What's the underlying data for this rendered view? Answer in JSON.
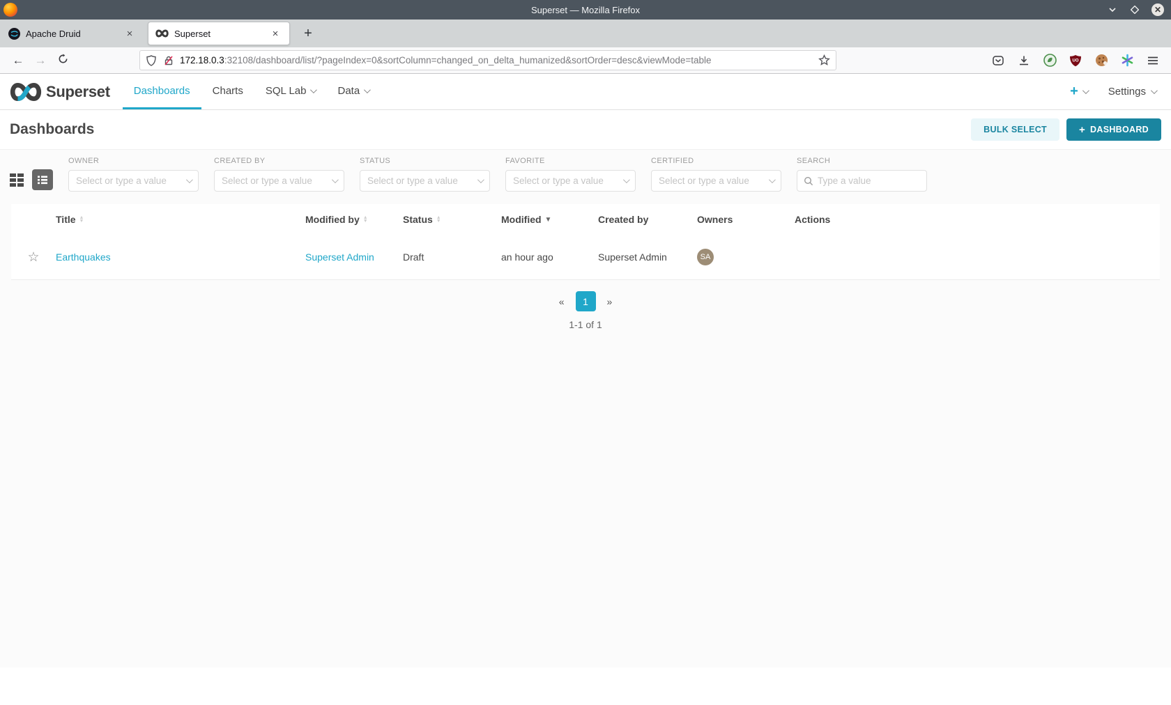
{
  "titlebar": {
    "title": "Superset — Mozilla Firefox"
  },
  "tabs": {
    "tab1": "Apache Druid",
    "tab2": "Superset",
    "close": "×",
    "new_tab": "+"
  },
  "browser": {
    "back": "←",
    "forward": "→",
    "url_host": "172.18.0.3",
    "url_rest": ":32108/dashboard/list/?pageIndex=0&sortColumn=changed_on_delta_humanized&sortOrder=desc&viewMode=table",
    "toolbar_icons": [
      "pocket-icon",
      "download-icon",
      "privacy-extension-icon",
      "ublock-icon",
      "cookie-extension-icon",
      "multiaccount-extension-icon",
      "menu-icon"
    ]
  },
  "navbar": {
    "brand": "Superset",
    "items": [
      {
        "label": "Dashboards"
      },
      {
        "label": "Charts"
      },
      {
        "label": "SQL Lab"
      },
      {
        "label": "Data"
      }
    ],
    "plus": "+",
    "settings": "Settings"
  },
  "submenu": {
    "title": "Dashboards",
    "bulk_select": "BULK SELECT",
    "new_plus": "+",
    "new_dashboard": "DASHBOARD"
  },
  "filters": {
    "owner": {
      "label": "OWNER",
      "placeholder": "Select or type a value"
    },
    "created_by": {
      "label": "CREATED BY",
      "placeholder": "Select or type a value"
    },
    "status": {
      "label": "STATUS",
      "placeholder": "Select or type a value"
    },
    "favorite": {
      "label": "FAVORITE",
      "placeholder": "Select or type a value"
    },
    "certified": {
      "label": "CERTIFIED",
      "placeholder": "Select or type a value"
    },
    "search": {
      "label": "SEARCH",
      "placeholder": "Type a value"
    }
  },
  "table": {
    "columns": [
      "Title",
      "Modified by",
      "Status",
      "Modified",
      "Created by",
      "Owners",
      "Actions"
    ],
    "rows": [
      {
        "title": "Earthquakes",
        "modified_by": "Superset Admin",
        "status": "Draft",
        "modified": "an hour ago",
        "created_by": "Superset Admin",
        "owner_initials": "SA"
      }
    ]
  },
  "pagination": {
    "prev": "«",
    "page": "1",
    "next": "»",
    "summary": "1-1 of 1"
  },
  "colors": {
    "accent": "#20a7c9",
    "accent_dark": "#1a85a0",
    "bulk_select_bg": "#e9f6f9",
    "avatar_bg": "#9d8d76"
  }
}
